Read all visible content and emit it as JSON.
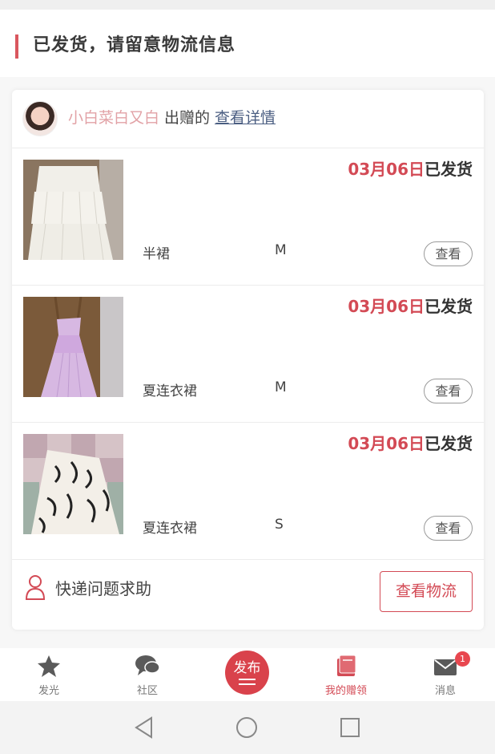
{
  "header": {
    "title": "已发货，请留意物流信息"
  },
  "card": {
    "donor_name": "小白菜白又白",
    "gave_text": "出赠的",
    "detail_link": "查看详情"
  },
  "items": [
    {
      "date": "03月06日",
      "status": "已发货",
      "name": "半裙",
      "size": "M",
      "view_label": "查看"
    },
    {
      "date": "03月06日",
      "status": "已发货",
      "name": "夏连衣裙",
      "size": "M",
      "view_label": "查看"
    },
    {
      "date": "03月06日",
      "status": "已发货",
      "name": "夏连衣裙",
      "size": "S",
      "view_label": "查看"
    }
  ],
  "footer": {
    "help_text": "快递问题求助",
    "logistics_button": "查看物流"
  },
  "tabbar": {
    "tabs": [
      {
        "label": "发光",
        "icon": "star-icon"
      },
      {
        "label": "社区",
        "icon": "chat-bubbles-icon"
      },
      {
        "label": "发布",
        "icon": "publish-icon"
      },
      {
        "label": "我的赠领",
        "icon": "book-icon",
        "active": true
      },
      {
        "label": "消息",
        "icon": "mail-icon",
        "badge": "1"
      }
    ]
  },
  "colors": {
    "accent": "#d34a55",
    "donor": "#e2a2a6",
    "link": "#4b5e82"
  }
}
